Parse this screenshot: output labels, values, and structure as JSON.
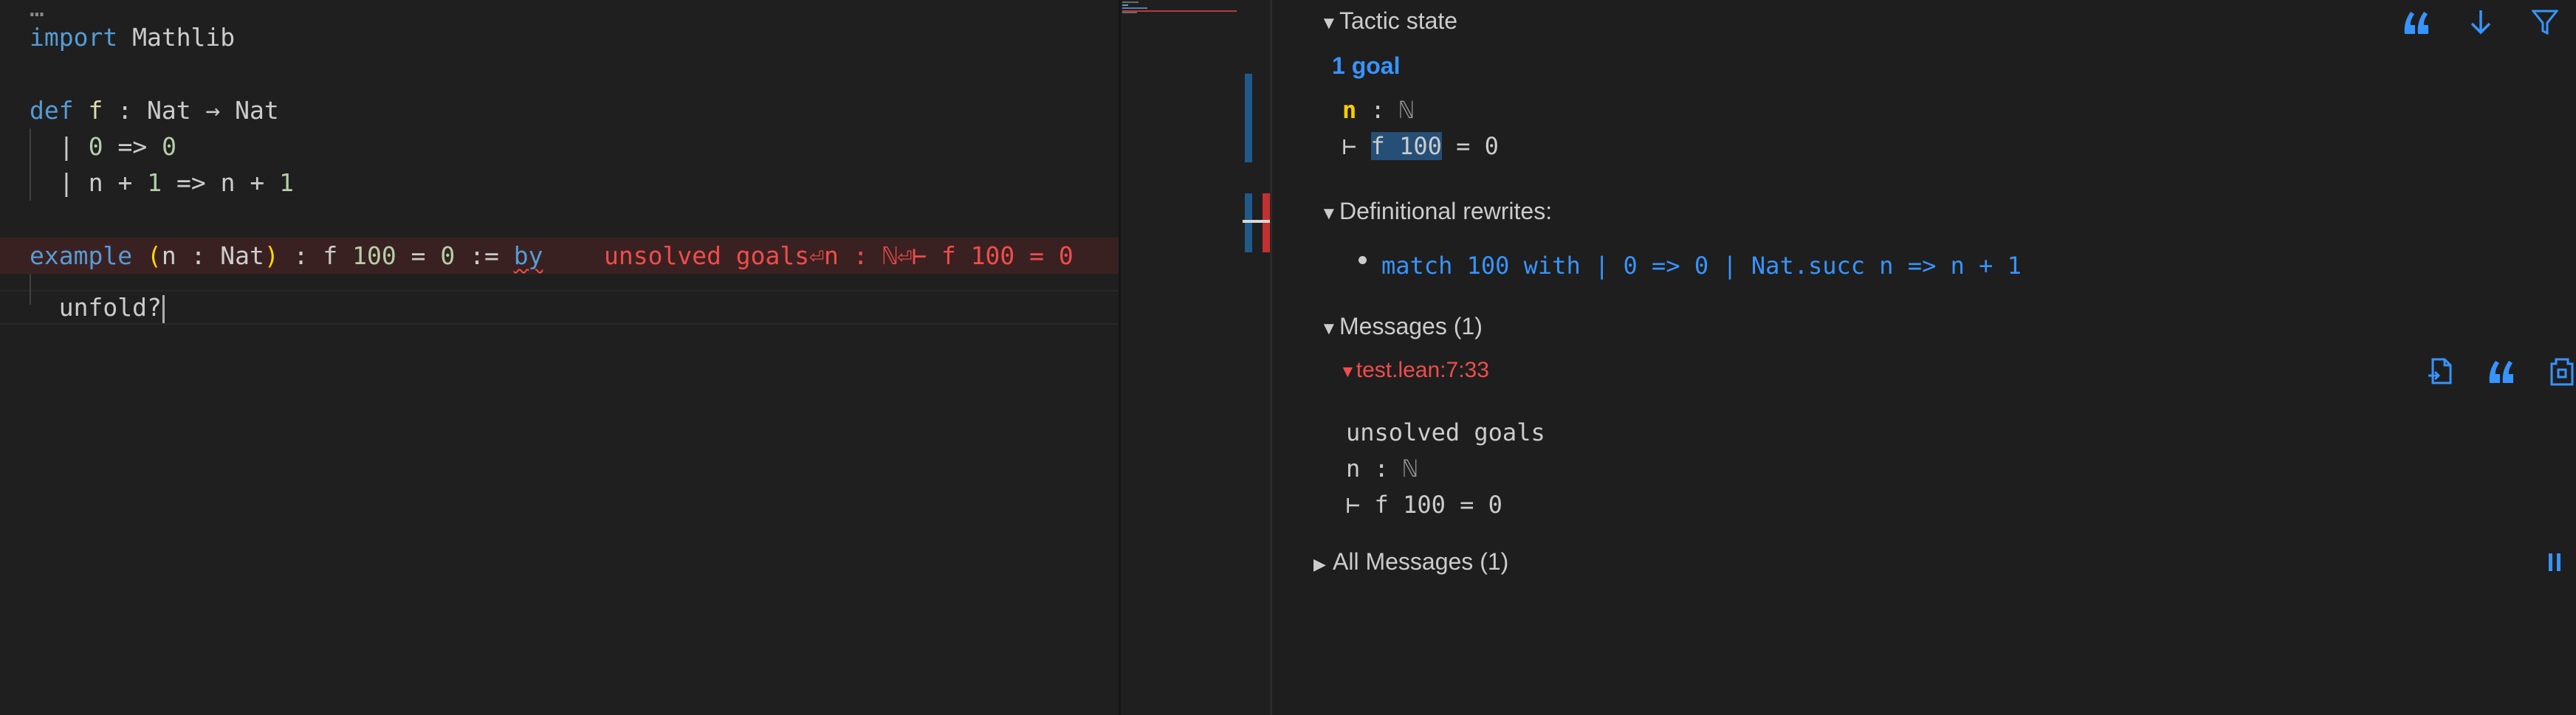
{
  "editor": {
    "fold_marker": "…",
    "lines": {
      "l1_kw": "import",
      "l1_rest": " Mathlib",
      "l3_kw": "def",
      "l3_name": " f",
      "l3_rest": " : Nat → Nat",
      "l4_pipe": "| ",
      "l4_a": "0",
      "l4_arrow": " => ",
      "l4_b": "0",
      "l5_pipe": "| ",
      "l5_a": "n + ",
      "l5_one": "1",
      "l5_arrow": " => n + ",
      "l5_one2": "1",
      "l7_kw": "example",
      "l7_open": " (",
      "l7_binder": "n : Nat",
      "l7_close": ")",
      "l7_mid": " : f ",
      "l7_hundred": "100",
      "l7_eq": " = ",
      "l7_zero": "0",
      "l7_assign": " := ",
      "l7_by": "by",
      "l7_error": "unsolved goals⏎n : ℕ⏎⊢ f 100 = 0",
      "l8_text": "  unfold?"
    }
  },
  "infoview": {
    "tactic_state": {
      "header": "Tactic state",
      "goal_count": "1 goal",
      "hyp_name": "n",
      "hyp_sep": " : ",
      "hyp_type": "ℕ",
      "turnstile": "⊢ ",
      "goal_hl": "f 100",
      "goal_rest": " = 0"
    },
    "rewrites": {
      "header": "Definitional rewrites:",
      "item": "match 100 with | 0 => 0 | Nat.succ n => n + 1"
    },
    "messages": {
      "header": "Messages (1)",
      "location": "test.lean:7:33",
      "body_line1": "unsolved goals",
      "body_line2_name": "n : ",
      "body_line2_type": "ℕ",
      "body_line3": "⊢ f 100 = 0"
    },
    "all_messages": {
      "header": "All Messages (1)"
    },
    "icons": {
      "copy_to_comment": "quote-icon",
      "scroll_to_bottom": "arrow-down-icon",
      "filter": "filter-icon",
      "go_to_file": "go-to-file-icon",
      "pin": "pin-icon",
      "pause": "pause-icon"
    }
  },
  "colors": {
    "keyword": "#569cd6",
    "number": "#b5cea8",
    "error": "#f14c4c",
    "link": "#3794ff",
    "hyp_name": "#ffcc00"
  }
}
